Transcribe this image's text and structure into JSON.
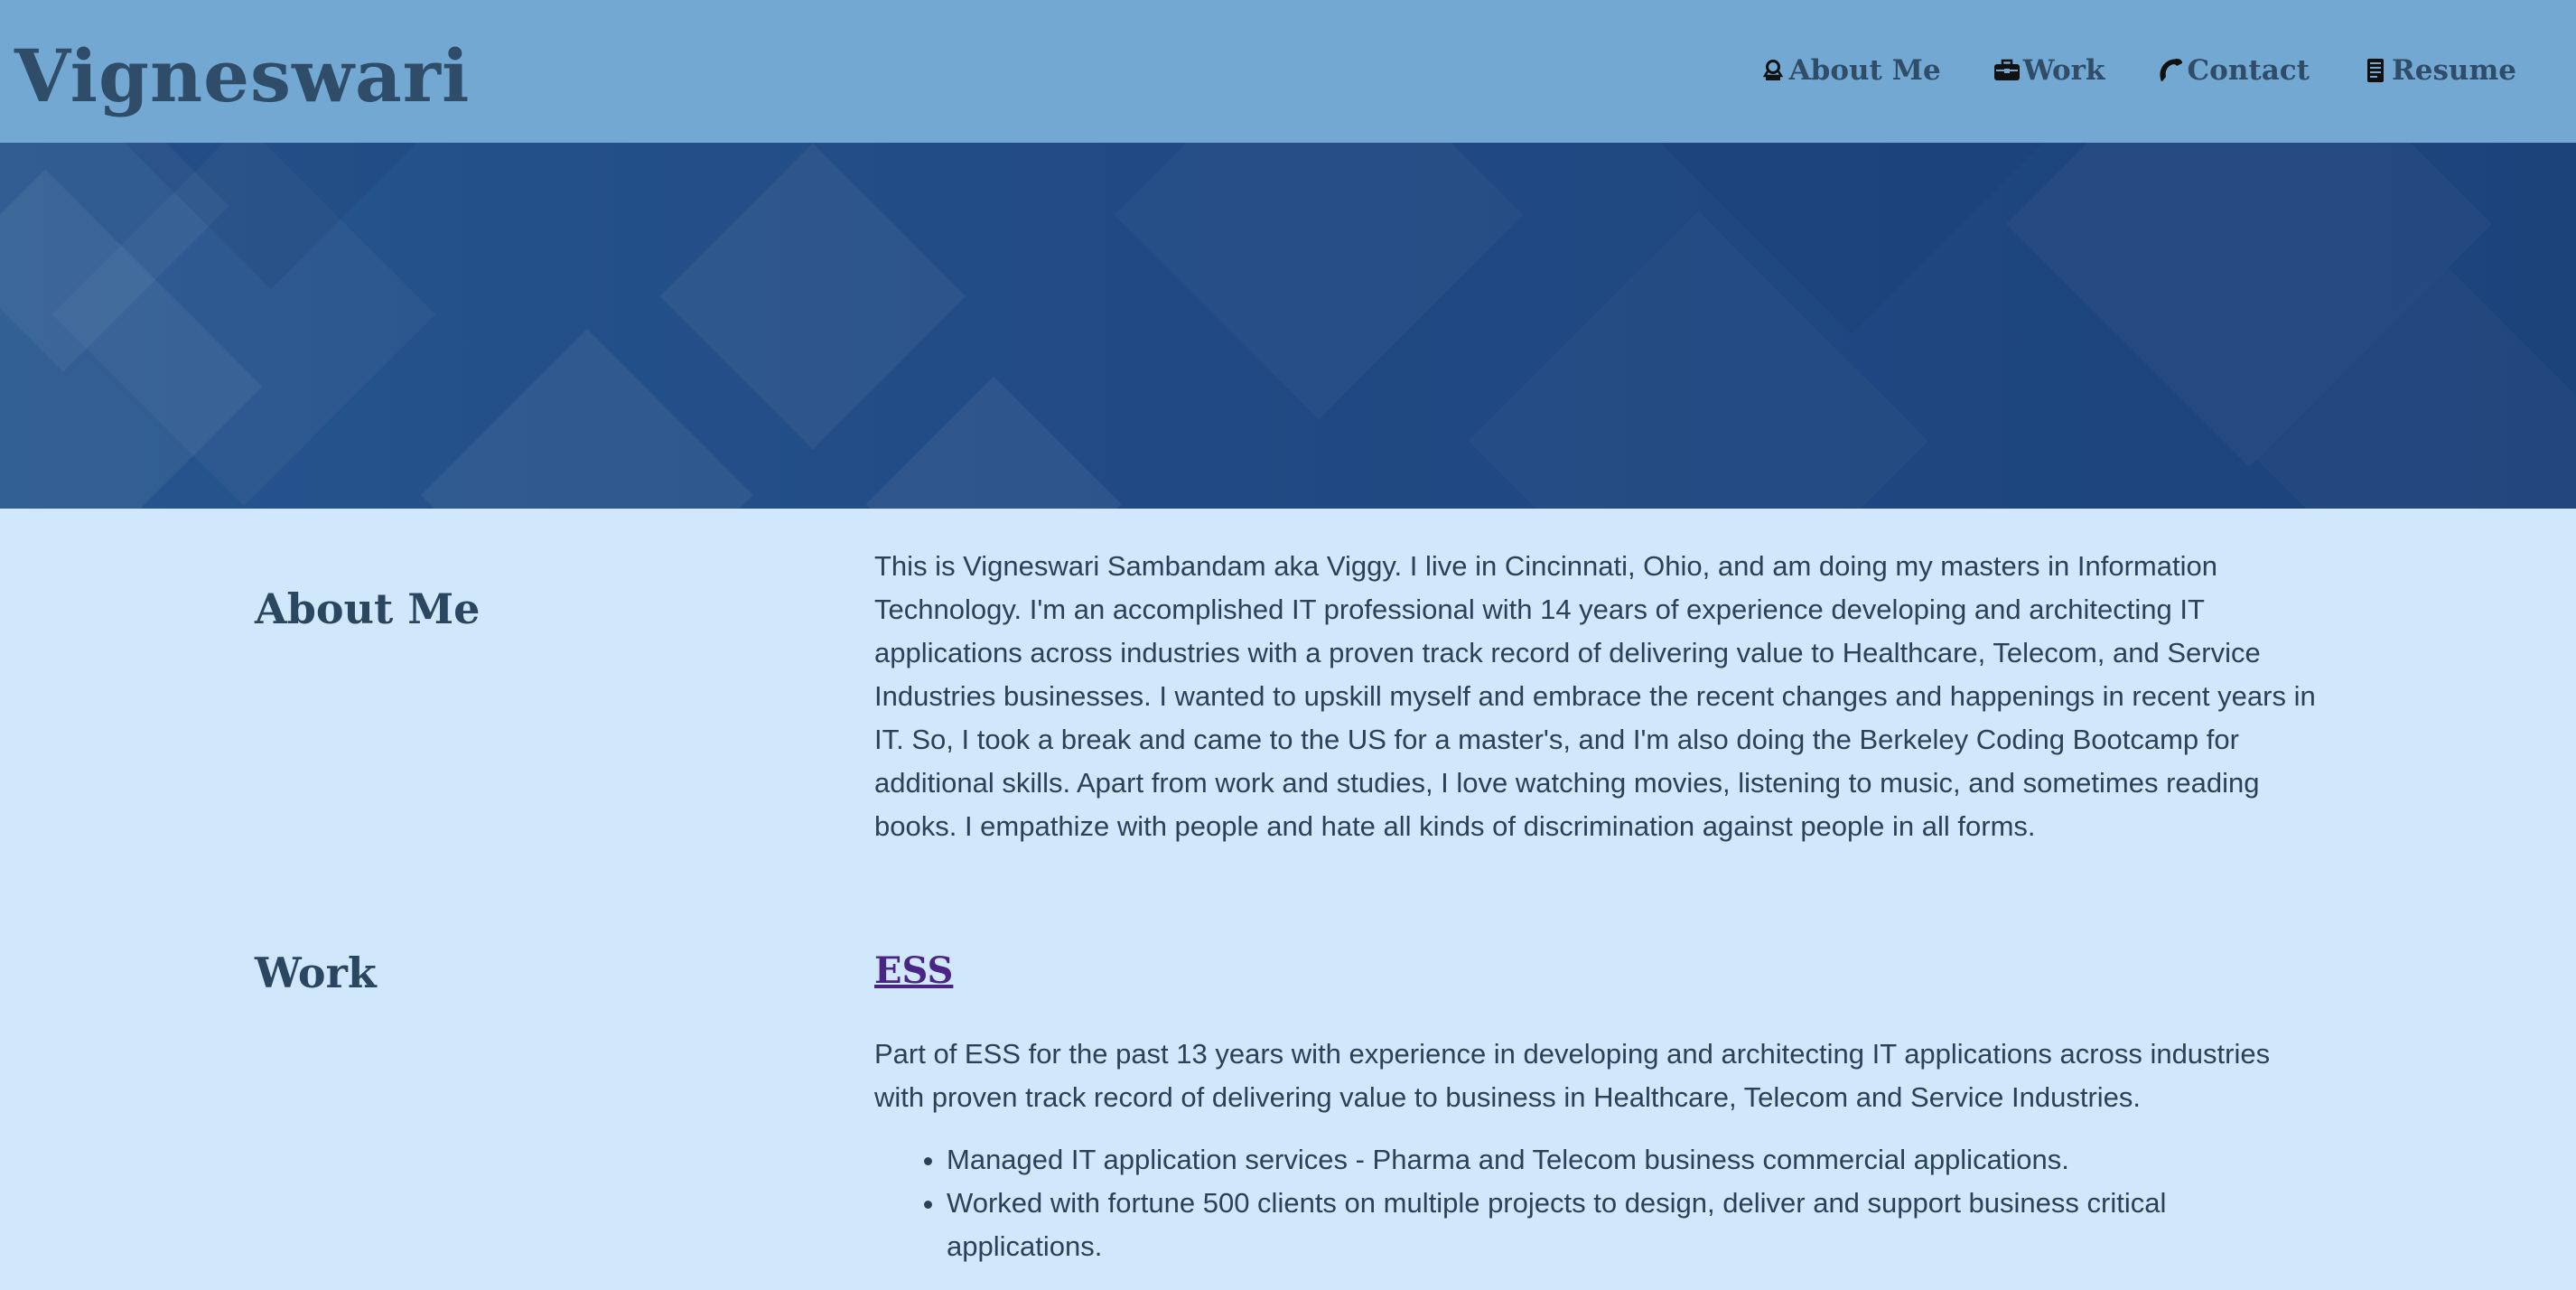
{
  "header": {
    "title": "Vigneswari",
    "nav": [
      {
        "label": "About Me",
        "icon": "woman-icon"
      },
      {
        "label": "Work",
        "icon": "briefcase-icon"
      },
      {
        "label": "Contact",
        "icon": "phone-icon"
      },
      {
        "label": "Resume",
        "icon": "document-icon"
      }
    ]
  },
  "about": {
    "heading": "About Me",
    "text": "This is Vigneswari Sambandam aka Viggy. I live in Cincinnati, Ohio, and am doing my masters in Information Technology. I'm an accomplished IT professional with 14 years of experience developing and architecting IT applications across industries with a proven track record of delivering value to Healthcare, Telecom, and Service Industries businesses. I wanted to upskill myself and embrace the recent changes and happenings in recent years in IT. So, I took a break and came to the US for a master's, and I'm also doing the Berkeley Coding Bootcamp for additional skills. Apart from work and studies, I love watching movies, listening to music, and sometimes reading books. I empathize with people and hate all kinds of discrimination against people in all forms."
  },
  "work": {
    "heading": "Work",
    "job_title": "ESS",
    "description": "Part of ESS for the past 13 years with experience in developing and architecting IT applications across industries with proven track record of delivering value to business in Healthcare, Telecom and Service Industries.",
    "bullets": [
      "Managed IT application services - Pharma and Telecom business commercial applications.",
      "Worked with fortune 500 clients on multiple projects to design, deliver and support business critical applications."
    ]
  },
  "colors": {
    "header_bg": "#72a8d2",
    "hero_bg": "#214a84",
    "content_bg": "#d0e7fc",
    "heading": "#2f4d68",
    "link_visited": "#4b2586"
  }
}
